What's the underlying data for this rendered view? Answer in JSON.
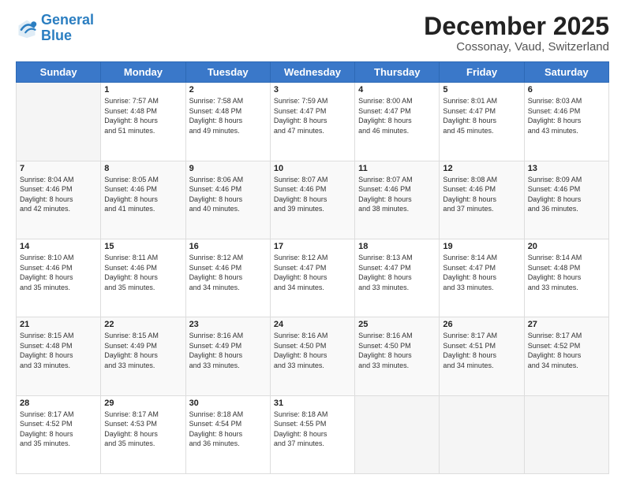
{
  "logo": {
    "line1": "General",
    "line2": "Blue"
  },
  "title": "December 2025",
  "subtitle": "Cossonay, Vaud, Switzerland",
  "days_header": [
    "Sunday",
    "Monday",
    "Tuesday",
    "Wednesday",
    "Thursday",
    "Friday",
    "Saturday"
  ],
  "weeks": [
    [
      {
        "num": "",
        "sunrise": "",
        "sunset": "",
        "daylight": ""
      },
      {
        "num": "1",
        "sunrise": "7:57 AM",
        "sunset": "4:48 PM",
        "daylight": "8 hours and 51 minutes."
      },
      {
        "num": "2",
        "sunrise": "7:58 AM",
        "sunset": "4:48 PM",
        "daylight": "8 hours and 49 minutes."
      },
      {
        "num": "3",
        "sunrise": "7:59 AM",
        "sunset": "4:47 PM",
        "daylight": "8 hours and 47 minutes."
      },
      {
        "num": "4",
        "sunrise": "8:00 AM",
        "sunset": "4:47 PM",
        "daylight": "8 hours and 46 minutes."
      },
      {
        "num": "5",
        "sunrise": "8:01 AM",
        "sunset": "4:47 PM",
        "daylight": "8 hours and 45 minutes."
      },
      {
        "num": "6",
        "sunrise": "8:03 AM",
        "sunset": "4:46 PM",
        "daylight": "8 hours and 43 minutes."
      }
    ],
    [
      {
        "num": "7",
        "sunrise": "8:04 AM",
        "sunset": "4:46 PM",
        "daylight": "8 hours and 42 minutes."
      },
      {
        "num": "8",
        "sunrise": "8:05 AM",
        "sunset": "4:46 PM",
        "daylight": "8 hours and 41 minutes."
      },
      {
        "num": "9",
        "sunrise": "8:06 AM",
        "sunset": "4:46 PM",
        "daylight": "8 hours and 40 minutes."
      },
      {
        "num": "10",
        "sunrise": "8:07 AM",
        "sunset": "4:46 PM",
        "daylight": "8 hours and 39 minutes."
      },
      {
        "num": "11",
        "sunrise": "8:07 AM",
        "sunset": "4:46 PM",
        "daylight": "8 hours and 38 minutes."
      },
      {
        "num": "12",
        "sunrise": "8:08 AM",
        "sunset": "4:46 PM",
        "daylight": "8 hours and 37 minutes."
      },
      {
        "num": "13",
        "sunrise": "8:09 AM",
        "sunset": "4:46 PM",
        "daylight": "8 hours and 36 minutes."
      }
    ],
    [
      {
        "num": "14",
        "sunrise": "8:10 AM",
        "sunset": "4:46 PM",
        "daylight": "8 hours and 35 minutes."
      },
      {
        "num": "15",
        "sunrise": "8:11 AM",
        "sunset": "4:46 PM",
        "daylight": "8 hours and 35 minutes."
      },
      {
        "num": "16",
        "sunrise": "8:12 AM",
        "sunset": "4:46 PM",
        "daylight": "8 hours and 34 minutes."
      },
      {
        "num": "17",
        "sunrise": "8:12 AM",
        "sunset": "4:47 PM",
        "daylight": "8 hours and 34 minutes."
      },
      {
        "num": "18",
        "sunrise": "8:13 AM",
        "sunset": "4:47 PM",
        "daylight": "8 hours and 33 minutes."
      },
      {
        "num": "19",
        "sunrise": "8:14 AM",
        "sunset": "4:47 PM",
        "daylight": "8 hours and 33 minutes."
      },
      {
        "num": "20",
        "sunrise": "8:14 AM",
        "sunset": "4:48 PM",
        "daylight": "8 hours and 33 minutes."
      }
    ],
    [
      {
        "num": "21",
        "sunrise": "8:15 AM",
        "sunset": "4:48 PM",
        "daylight": "8 hours and 33 minutes."
      },
      {
        "num": "22",
        "sunrise": "8:15 AM",
        "sunset": "4:49 PM",
        "daylight": "8 hours and 33 minutes."
      },
      {
        "num": "23",
        "sunrise": "8:16 AM",
        "sunset": "4:49 PM",
        "daylight": "8 hours and 33 minutes."
      },
      {
        "num": "24",
        "sunrise": "8:16 AM",
        "sunset": "4:50 PM",
        "daylight": "8 hours and 33 minutes."
      },
      {
        "num": "25",
        "sunrise": "8:16 AM",
        "sunset": "4:50 PM",
        "daylight": "8 hours and 33 minutes."
      },
      {
        "num": "26",
        "sunrise": "8:17 AM",
        "sunset": "4:51 PM",
        "daylight": "8 hours and 34 minutes."
      },
      {
        "num": "27",
        "sunrise": "8:17 AM",
        "sunset": "4:52 PM",
        "daylight": "8 hours and 34 minutes."
      }
    ],
    [
      {
        "num": "28",
        "sunrise": "8:17 AM",
        "sunset": "4:52 PM",
        "daylight": "8 hours and 35 minutes."
      },
      {
        "num": "29",
        "sunrise": "8:17 AM",
        "sunset": "4:53 PM",
        "daylight": "8 hours and 35 minutes."
      },
      {
        "num": "30",
        "sunrise": "8:18 AM",
        "sunset": "4:54 PM",
        "daylight": "8 hours and 36 minutes."
      },
      {
        "num": "31",
        "sunrise": "8:18 AM",
        "sunset": "4:55 PM",
        "daylight": "8 hours and 37 minutes."
      },
      {
        "num": "",
        "sunrise": "",
        "sunset": "",
        "daylight": ""
      },
      {
        "num": "",
        "sunrise": "",
        "sunset": "",
        "daylight": ""
      },
      {
        "num": "",
        "sunrise": "",
        "sunset": "",
        "daylight": ""
      }
    ]
  ]
}
